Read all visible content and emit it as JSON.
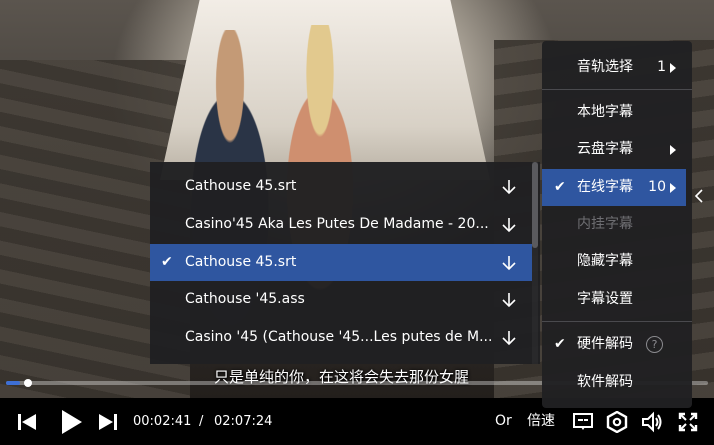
{
  "player": {
    "subtitle_line": "只是单纯的你，在这将会失去那份女腥",
    "progress_fraction": 0.02,
    "current_time": "00:02:41",
    "time_separator": "/",
    "total_time": "02:07:24",
    "or_label": "Or",
    "speed_label": "倍速",
    "accent_color": "#2f56a0"
  },
  "side_menu": {
    "items": [
      {
        "label": "音轨选择",
        "value": "1",
        "has_arrow": true
      },
      {
        "label": "本地字幕"
      },
      {
        "label": "云盘字幕",
        "has_arrow": true
      },
      {
        "label": "在线字幕",
        "value": "10",
        "has_arrow": true,
        "checked": true
      },
      {
        "label": "内挂字幕",
        "disabled": true
      },
      {
        "label": "隐藏字幕"
      },
      {
        "label": "字幕设置"
      },
      {
        "label": "硬件解码",
        "checked": true,
        "help": "?"
      },
      {
        "label": "软件解码"
      }
    ]
  },
  "online_subtitles": {
    "items": [
      {
        "name": "Cathouse 45.srt"
      },
      {
        "name": "Casino'45 Aka Les Putes De Madame - 20..."
      },
      {
        "name": "Cathouse 45.srt",
        "selected": true
      },
      {
        "name": "Cathouse '45.ass"
      },
      {
        "name": "Casino '45 (Cathouse '45...Les putes de M..."
      }
    ],
    "check_glyph": "✔"
  },
  "icons": {
    "prev": "skip-previous-icon",
    "play": "play-icon",
    "next": "skip-next-icon",
    "subtitle": "subtitle-icon",
    "settings": "settings-icon",
    "volume": "volume-icon",
    "fullscreen": "fullscreen-icon",
    "download": "download-icon",
    "collapse": "chevron-left-icon"
  }
}
